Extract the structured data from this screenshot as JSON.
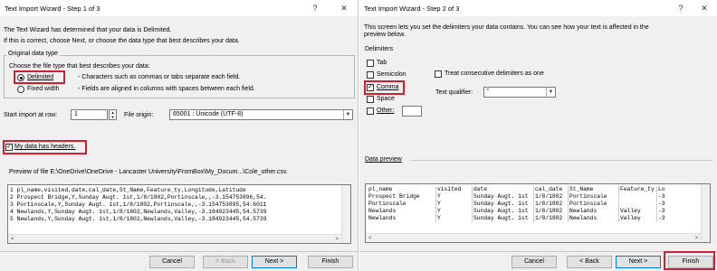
{
  "step1": {
    "title": "Text Import Wizard - Step 1 of 3",
    "help": "?",
    "close": "✕",
    "intro1": "The Text Wizard has determined that your data is Delimited.",
    "intro2": "If this is correct, choose Next, or choose the data type that best describes your data.",
    "group_title": "Original data type",
    "group_prompt": "Choose the file type that best describes your data:",
    "delimited_label": "Delimited",
    "delimited_desc": "- Characters such as commas or tabs separate each field.",
    "fixed_label": "Fixed width",
    "fixed_desc": "- Fields are aligned in columns with spaces between each field.",
    "start_row_label": "Start import at row:",
    "start_row_value": "1",
    "file_origin_label": "File origin:",
    "file_origin_value": "65001 : Unicode (UTF-8)",
    "headers_label": "My data has headers.",
    "preview_label": "Preview of file E:\\OneDrive\\OneDrive - Lancaster University\\FromBox\\My_Docum...\\Cole_other.csv.",
    "preview_lines": [
      "1 pl_name,visited,date,cal_date,St_Name,Feature_ty,Longitude,Latitude",
      "2 Prospect Bridge,Y,Sunday Augt. 1st,1/8/1802,Portinscale,,-3.154753896,54.",
      "3 Portinscale,Y,Sunday Augt. 1st,1/8/1802,Portinscale,,-3.154753895,54.6011",
      "4 Newlands,Y,Sunday Augt. 1st,1/8/1802,Newlands,Valley,-3.184923445,54.5739",
      "5 Newlands,Y,Sunday Augt. 1st,1/8/1802,Newlands,Valley,-3.184923445,54.5739"
    ],
    "buttons": {
      "cancel": "Cancel",
      "back": "< Back",
      "next": "Next >",
      "finish": "Finish"
    }
  },
  "step2": {
    "title": "Text Import Wizard - Step 2 of 3",
    "help": "?",
    "close": "✕",
    "intro": "This screen lets you set the delimiters your data contains. You can see how your text is affected in the",
    "intro_2": "preview below.",
    "delimiters_title": "Delimiters",
    "tab_label": "Tab",
    "semicolon_label": "Semicolon",
    "comma_label": "Comma",
    "space_label": "Space",
    "other_label": "Other:",
    "consecutive_label": "Treat consecutive delimiters as one",
    "qualifier_label": "Text qualifier:",
    "qualifier_value": "\"",
    "data_preview_label": "Data preview",
    "columns": [
      "pl_name",
      "visited",
      "date",
      "cal_date",
      "St_Name",
      "Feature_ty",
      "Lo"
    ],
    "rows": [
      [
        "Prospect Bridge",
        "Y",
        "Sunday Augt. 1st",
        "1/8/1802",
        "Portinscale",
        "",
        "-3"
      ],
      [
        "Portinscale",
        "Y",
        "Sunday Augt. 1st",
        "1/8/1802",
        "Portinscale",
        "",
        "-3"
      ],
      [
        "Newlands",
        "Y",
        "Sunday Augt. 1st",
        "1/8/1802",
        "Newlands",
        "Valley",
        "-3"
      ],
      [
        "Newlands",
        "Y",
        "Sunday Augt. 1st",
        "1/8/1802",
        "Newlands",
        "Valley",
        "-3"
      ]
    ],
    "buttons": {
      "cancel": "Cancel",
      "back": "< Back",
      "next": "Next >",
      "finish": "Finish"
    }
  },
  "colors": {
    "highlight": "#d0202a",
    "primary_border": "#0078d7",
    "dialog_bg": "#f0f0f0"
  }
}
